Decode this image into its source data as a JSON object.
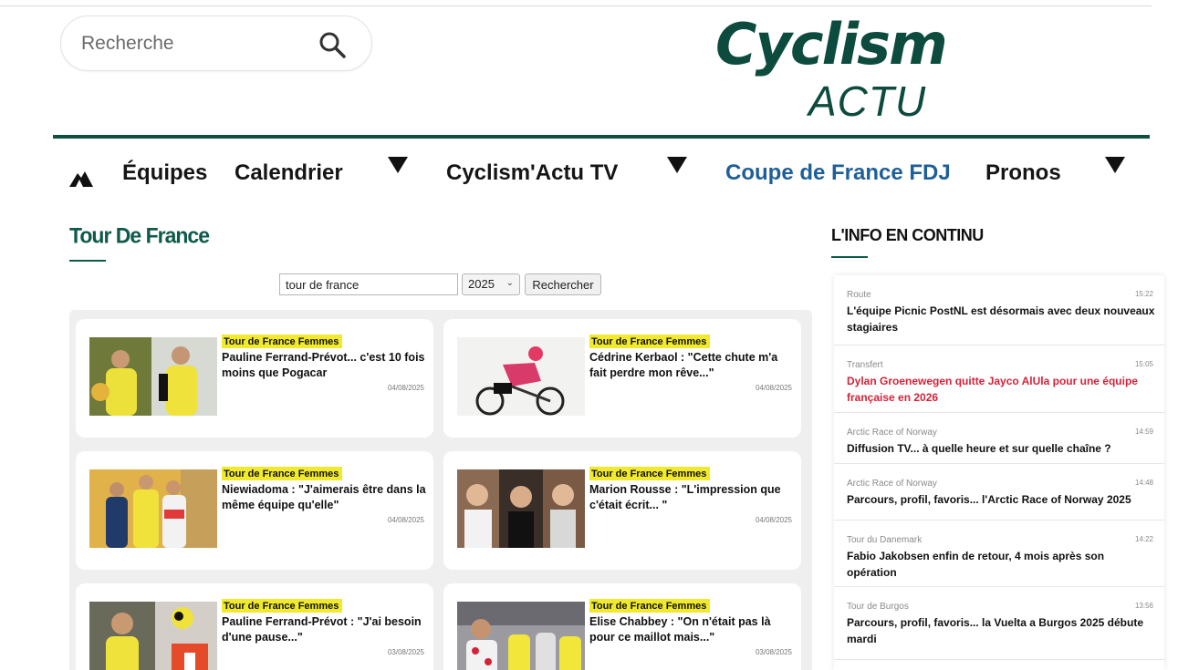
{
  "search": {
    "placeholder": "Recherche"
  },
  "logo": {
    "word": "Cyclism",
    "sub": "ACTU"
  },
  "nav": {
    "items": [
      "Équipes",
      "Calendrier",
      "Cyclism'Actu TV",
      "Coupe de France FDJ",
      "Pronos"
    ]
  },
  "section": {
    "title": "Tour De France"
  },
  "filter": {
    "query": "tour de france",
    "year": "2025",
    "button": "Rechercher"
  },
  "cards": [
    {
      "tag": "Tour de France Femmes",
      "title": "Pauline Ferrand-Prévot... c'est 10 fois moins que Pogacar",
      "date": "04/08/2025"
    },
    {
      "tag": "Tour de France Femmes",
      "title": "Cédrine Kerbaol : \"Cette chute m'a fait perdre mon rêve...\"",
      "date": "04/08/2025"
    },
    {
      "tag": "Tour de France Femmes",
      "title": "Niewiadoma : \"J'aimerais être dans la même équipe qu'elle\"",
      "date": "04/08/2025"
    },
    {
      "tag": "Tour de France Femmes",
      "title": "Marion Rousse : \"L'impression que c'était écrit... \"",
      "date": "04/08/2025"
    },
    {
      "tag": "Tour de France Femmes",
      "title": "Pauline Ferrand-Prévot : \"J'ai besoin d'une pause...\"",
      "date": "03/08/2025"
    },
    {
      "tag": "Tour de France Femmes",
      "title": "Elise Chabbey : \"On n'était pas là pour ce maillot mais...\"",
      "date": "03/08/2025"
    }
  ],
  "sidebar": {
    "title": "L'INFO EN CONTINU",
    "items": [
      {
        "category": "Route",
        "time": "15:22",
        "headline": "L'équipe Picnic PostNL est désormais avec deux nouveaux stagiaires",
        "highlight": false
      },
      {
        "category": "Transfert",
        "time": "15:05",
        "headline": "Dylan Groenewegen quitte Jayco AlUla pour une équipe française en 2026",
        "highlight": true
      },
      {
        "category": "Arctic Race of Norway",
        "time": "14:59",
        "headline": "Diffusion TV... à quelle heure et sur quelle chaîne ?",
        "highlight": false
      },
      {
        "category": "Arctic Race of Norway",
        "time": "14:48",
        "headline": "Parcours, profil, favoris... l'Arctic Race of Norway 2025",
        "highlight": false
      },
      {
        "category": "Tour du Danemark",
        "time": "14:22",
        "headline": "Fabio Jakobsen enfin de retour, 4 mois après son opération",
        "highlight": false
      },
      {
        "category": "Tour de Burgos",
        "time": "13:56",
        "headline": "Parcours, profil, favoris... la Vuelta a Burgos 2025 débute mardi",
        "highlight": false
      }
    ]
  },
  "colors": {
    "brand": "#0c4b3e",
    "link": "#1f5f98",
    "tag": "#f1e92b",
    "alert": "#d52238"
  }
}
